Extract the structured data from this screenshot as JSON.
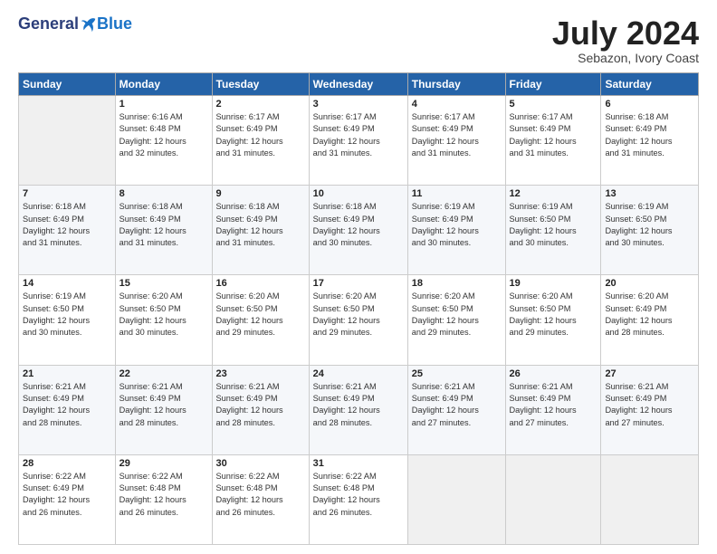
{
  "logo": {
    "general": "General",
    "blue": "Blue"
  },
  "title": {
    "month_year": "July 2024",
    "location": "Sebazon, Ivory Coast"
  },
  "weekdays": [
    "Sunday",
    "Monday",
    "Tuesday",
    "Wednesday",
    "Thursday",
    "Friday",
    "Saturday"
  ],
  "weeks": [
    [
      {
        "num": "",
        "info": ""
      },
      {
        "num": "1",
        "info": "Sunrise: 6:16 AM\nSunset: 6:48 PM\nDaylight: 12 hours\nand 32 minutes."
      },
      {
        "num": "2",
        "info": "Sunrise: 6:17 AM\nSunset: 6:49 PM\nDaylight: 12 hours\nand 31 minutes."
      },
      {
        "num": "3",
        "info": "Sunrise: 6:17 AM\nSunset: 6:49 PM\nDaylight: 12 hours\nand 31 minutes."
      },
      {
        "num": "4",
        "info": "Sunrise: 6:17 AM\nSunset: 6:49 PM\nDaylight: 12 hours\nand 31 minutes."
      },
      {
        "num": "5",
        "info": "Sunrise: 6:17 AM\nSunset: 6:49 PM\nDaylight: 12 hours\nand 31 minutes."
      },
      {
        "num": "6",
        "info": "Sunrise: 6:18 AM\nSunset: 6:49 PM\nDaylight: 12 hours\nand 31 minutes."
      }
    ],
    [
      {
        "num": "7",
        "info": "Sunrise: 6:18 AM\nSunset: 6:49 PM\nDaylight: 12 hours\nand 31 minutes."
      },
      {
        "num": "8",
        "info": "Sunrise: 6:18 AM\nSunset: 6:49 PM\nDaylight: 12 hours\nand 31 minutes."
      },
      {
        "num": "9",
        "info": "Sunrise: 6:18 AM\nSunset: 6:49 PM\nDaylight: 12 hours\nand 31 minutes."
      },
      {
        "num": "10",
        "info": "Sunrise: 6:18 AM\nSunset: 6:49 PM\nDaylight: 12 hours\nand 30 minutes."
      },
      {
        "num": "11",
        "info": "Sunrise: 6:19 AM\nSunset: 6:49 PM\nDaylight: 12 hours\nand 30 minutes."
      },
      {
        "num": "12",
        "info": "Sunrise: 6:19 AM\nSunset: 6:50 PM\nDaylight: 12 hours\nand 30 minutes."
      },
      {
        "num": "13",
        "info": "Sunrise: 6:19 AM\nSunset: 6:50 PM\nDaylight: 12 hours\nand 30 minutes."
      }
    ],
    [
      {
        "num": "14",
        "info": "Sunrise: 6:19 AM\nSunset: 6:50 PM\nDaylight: 12 hours\nand 30 minutes."
      },
      {
        "num": "15",
        "info": "Sunrise: 6:20 AM\nSunset: 6:50 PM\nDaylight: 12 hours\nand 30 minutes."
      },
      {
        "num": "16",
        "info": "Sunrise: 6:20 AM\nSunset: 6:50 PM\nDaylight: 12 hours\nand 29 minutes."
      },
      {
        "num": "17",
        "info": "Sunrise: 6:20 AM\nSunset: 6:50 PM\nDaylight: 12 hours\nand 29 minutes."
      },
      {
        "num": "18",
        "info": "Sunrise: 6:20 AM\nSunset: 6:50 PM\nDaylight: 12 hours\nand 29 minutes."
      },
      {
        "num": "19",
        "info": "Sunrise: 6:20 AM\nSunset: 6:50 PM\nDaylight: 12 hours\nand 29 minutes."
      },
      {
        "num": "20",
        "info": "Sunrise: 6:20 AM\nSunset: 6:49 PM\nDaylight: 12 hours\nand 28 minutes."
      }
    ],
    [
      {
        "num": "21",
        "info": "Sunrise: 6:21 AM\nSunset: 6:49 PM\nDaylight: 12 hours\nand 28 minutes."
      },
      {
        "num": "22",
        "info": "Sunrise: 6:21 AM\nSunset: 6:49 PM\nDaylight: 12 hours\nand 28 minutes."
      },
      {
        "num": "23",
        "info": "Sunrise: 6:21 AM\nSunset: 6:49 PM\nDaylight: 12 hours\nand 28 minutes."
      },
      {
        "num": "24",
        "info": "Sunrise: 6:21 AM\nSunset: 6:49 PM\nDaylight: 12 hours\nand 28 minutes."
      },
      {
        "num": "25",
        "info": "Sunrise: 6:21 AM\nSunset: 6:49 PM\nDaylight: 12 hours\nand 27 minutes."
      },
      {
        "num": "26",
        "info": "Sunrise: 6:21 AM\nSunset: 6:49 PM\nDaylight: 12 hours\nand 27 minutes."
      },
      {
        "num": "27",
        "info": "Sunrise: 6:21 AM\nSunset: 6:49 PM\nDaylight: 12 hours\nand 27 minutes."
      }
    ],
    [
      {
        "num": "28",
        "info": "Sunrise: 6:22 AM\nSunset: 6:49 PM\nDaylight: 12 hours\nand 26 minutes."
      },
      {
        "num": "29",
        "info": "Sunrise: 6:22 AM\nSunset: 6:48 PM\nDaylight: 12 hours\nand 26 minutes."
      },
      {
        "num": "30",
        "info": "Sunrise: 6:22 AM\nSunset: 6:48 PM\nDaylight: 12 hours\nand 26 minutes."
      },
      {
        "num": "31",
        "info": "Sunrise: 6:22 AM\nSunset: 6:48 PM\nDaylight: 12 hours\nand 26 minutes."
      },
      {
        "num": "",
        "info": ""
      },
      {
        "num": "",
        "info": ""
      },
      {
        "num": "",
        "info": ""
      }
    ]
  ]
}
